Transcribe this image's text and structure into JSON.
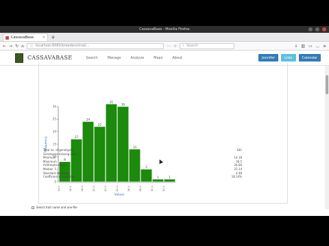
{
  "window": {
    "title": "CassavaBase - Mozilla Firefox"
  },
  "tab": {
    "label": "CassavaBase"
  },
  "url": "localhost:8080/breeders/trial/...",
  "search_placeholder": "Search",
  "site": {
    "logo_text": "CASSAVABASE",
    "menu": [
      "Search",
      "Manage",
      "Analyze",
      "Maps",
      "About"
    ],
    "buttons": [
      "Jennifer",
      "Lists",
      "Calendar"
    ]
  },
  "chart_data": {
    "type": "bar",
    "ylabel": "Frequency",
    "xlabel": "Values",
    "ylim": [
      0,
      30
    ],
    "yticks": [
      0,
      5,
      10,
      15,
      20,
      25,
      30
    ],
    "categories": [
      "14.1",
      "16.1",
      "18.1",
      "20.1",
      "22.1",
      "24.1",
      "26.1",
      "28.1",
      "30.1",
      "32.1"
    ],
    "values": [
      8,
      17,
      24,
      22,
      31,
      30,
      13,
      5,
      1,
      1
    ],
    "value_labels": [
      "8",
      "17",
      "24",
      "22",
      "31",
      "30",
      "13",
      "5",
      "1",
      "1"
    ],
    "bar_color": "#1c8a0c"
  },
  "stats": [
    {
      "label": "Total no. of genotypes",
      "value": "181"
    },
    {
      "label": "Genotypes missing data",
      "value": ""
    },
    {
      "label": "Minimum",
      "value": "14.18"
    },
    {
      "label": "Maximum",
      "value": "36.5"
    },
    {
      "label": "Arithmetic mean",
      "value": "24.66"
    },
    {
      "label": "Median",
      "value": "25.14"
    },
    {
      "label": "Standard deviation",
      "value": "4.48"
    },
    {
      "label": "Coefficient of variation",
      "value": "18.14%"
    }
  ],
  "checkbox_label": "Select trait name and one-file"
}
